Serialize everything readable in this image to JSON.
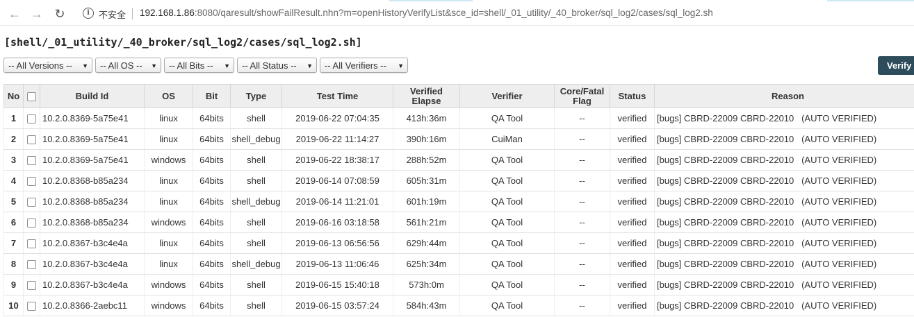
{
  "browser": {
    "security_label": "不安全",
    "url_host": "192.168.1.86",
    "url_rest": ":8080/qaresult/showFailResult.nhn?m=openHistoryVerifyList&sce_id=shell/_01_utility/_40_broker/sql_log2/cases/sql_log2.sh",
    "back_icon": "←",
    "forward_icon": "→",
    "reload_icon": "↻",
    "info_icon": "i"
  },
  "page": {
    "title": "[shell/_01_utility/_40_broker/sql_log2/cases/sql_log2.sh]"
  },
  "filters": {
    "versions": "-- All Versions --",
    "os": "-- All OS --",
    "bits": "-- All Bits --",
    "status": "-- All Status --",
    "verifiers": "-- All Verifiers --",
    "caret": "▼"
  },
  "verify_button": "Verify",
  "table": {
    "headers": {
      "no": "No",
      "build_id": "Build Id",
      "os": "OS",
      "bit": "Bit",
      "type": "Type",
      "test_time": "Test Time",
      "verified_elapse_1": "Verified",
      "verified_elapse_2": "Elapse",
      "verifier": "Verifier",
      "core_fatal_1": "Core/Fatal",
      "core_fatal_2": "Flag",
      "status": "Status",
      "reason": "Reason"
    },
    "rows": [
      {
        "no": "1",
        "build_id": "10.2.0.8369-5a75e41",
        "os": "linux",
        "bit": "64bits",
        "type": "shell",
        "test_time": "2019-06-22 07:04:35",
        "elapse": "413h:36m",
        "verifier": "QA Tool",
        "flag": "--",
        "status": "verified",
        "reason": "[bugs] CBRD-22009 CBRD-22010   (AUTO VERIFIED)"
      },
      {
        "no": "2",
        "build_id": "10.2.0.8369-5a75e41",
        "os": "linux",
        "bit": "64bits",
        "type": "shell_debug",
        "test_time": "2019-06-22 11:14:27",
        "elapse": "390h:16m",
        "verifier": "CuiMan",
        "flag": "--",
        "status": "verified",
        "reason": "[bugs] CBRD-22009 CBRD-22010   (AUTO VERIFIED)"
      },
      {
        "no": "3",
        "build_id": "10.2.0.8369-5a75e41",
        "os": "windows",
        "bit": "64bits",
        "type": "shell",
        "test_time": "2019-06-22 18:38:17",
        "elapse": "288h:52m",
        "verifier": "QA Tool",
        "flag": "--",
        "status": "verified",
        "reason": "[bugs] CBRD-22009 CBRD-22010   (AUTO VERIFIED)"
      },
      {
        "no": "4",
        "build_id": "10.2.0.8368-b85a234",
        "os": "linux",
        "bit": "64bits",
        "type": "shell",
        "test_time": "2019-06-14 07:08:59",
        "elapse": "605h:31m",
        "verifier": "QA Tool",
        "flag": "--",
        "status": "verified",
        "reason": "[bugs] CBRD-22009 CBRD-22010   (AUTO VERIFIED)"
      },
      {
        "no": "5",
        "build_id": "10.2.0.8368-b85a234",
        "os": "linux",
        "bit": "64bits",
        "type": "shell_debug",
        "test_time": "2019-06-14 11:21:01",
        "elapse": "601h:19m",
        "verifier": "QA Tool",
        "flag": "--",
        "status": "verified",
        "reason": "[bugs] CBRD-22009 CBRD-22010   (AUTO VERIFIED)"
      },
      {
        "no": "6",
        "build_id": "10.2.0.8368-b85a234",
        "os": "windows",
        "bit": "64bits",
        "type": "shell",
        "test_time": "2019-06-16 03:18:58",
        "elapse": "561h:21m",
        "verifier": "QA Tool",
        "flag": "--",
        "status": "verified",
        "reason": "[bugs] CBRD-22009 CBRD-22010   (AUTO VERIFIED)"
      },
      {
        "no": "7",
        "build_id": "10.2.0.8367-b3c4e4a",
        "os": "linux",
        "bit": "64bits",
        "type": "shell",
        "test_time": "2019-06-13 06:56:56",
        "elapse": "629h:44m",
        "verifier": "QA Tool",
        "flag": "--",
        "status": "verified",
        "reason": "[bugs] CBRD-22009 CBRD-22010   (AUTO VERIFIED)"
      },
      {
        "no": "8",
        "build_id": "10.2.0.8367-b3c4e4a",
        "os": "linux",
        "bit": "64bits",
        "type": "shell_debug",
        "test_time": "2019-06-13 11:06:46",
        "elapse": "625h:34m",
        "verifier": "QA Tool",
        "flag": "--",
        "status": "verified",
        "reason": "[bugs] CBRD-22009 CBRD-22010   (AUTO VERIFIED)"
      },
      {
        "no": "9",
        "build_id": "10.2.0.8367-b3c4e4a",
        "os": "windows",
        "bit": "64bits",
        "type": "shell",
        "test_time": "2019-06-15 15:40:18",
        "elapse": "573h:0m",
        "verifier": "QA Tool",
        "flag": "--",
        "status": "verified",
        "reason": "[bugs] CBRD-22009 CBRD-22010   (AUTO VERIFIED)"
      },
      {
        "no": "10",
        "build_id": "10.2.0.8366-2aebc11",
        "os": "windows",
        "bit": "64bits",
        "type": "shell",
        "test_time": "2019-06-15 03:57:24",
        "elapse": "584h:43m",
        "verifier": "QA Tool",
        "flag": "--",
        "status": "verified",
        "reason": "[bugs] CBRD-22009 CBRD-22010   (AUTO VERIFIED)"
      }
    ]
  },
  "colors": {
    "verify_button_bg": "#2e4d5c",
    "header_bg": "#eeeeee"
  }
}
